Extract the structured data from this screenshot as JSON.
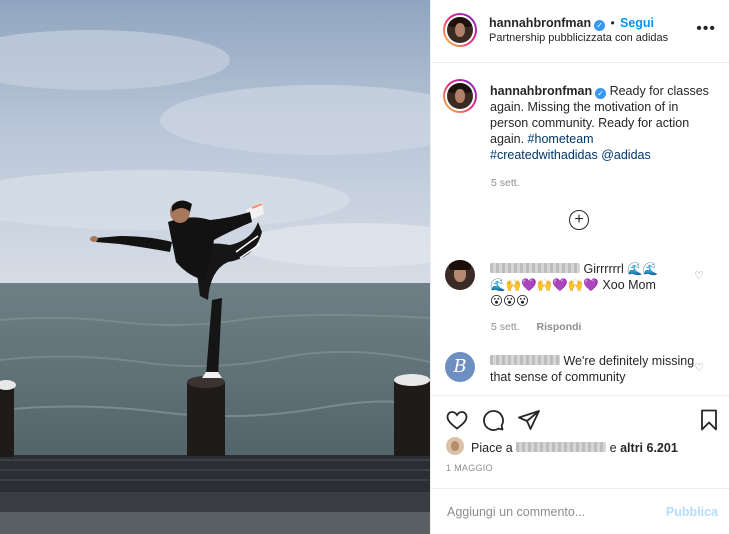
{
  "post": {
    "author": "hannahbronfman",
    "follow_label": "Segui",
    "partnership": "Partnership pubblicizzata con adidas",
    "more_icon": "more-options-icon",
    "caption_part1": "Ready for classes again. Missing the motivation of in person community. Ready for action again.",
    "caption_hashtag1": "#hometeam",
    "caption_hashtag2": "#createdwithadidas",
    "caption_mention": "@adidas",
    "caption_time": "5 sett.",
    "load_more_icon": "plus-circle-icon"
  },
  "comments": [
    {
      "text_line1": "Girrrrrrl 🌊🌊",
      "text_line2": "🌊🙌💜🙌💜🙌💜 Xoo Mom",
      "text_line3": "😮😮😮",
      "time": "5 sett.",
      "reply_label": "Rispondi"
    },
    {
      "text": "We're definitely missing that sense of community"
    }
  ],
  "actions": {
    "likes_prefix": "Piace a",
    "likes_suffix": "e",
    "likes_count": "altri 6.201",
    "date": "1 MAGGIO"
  },
  "comment_box": {
    "placeholder": "Aggiungi un commento...",
    "publish_label": "Pubblica"
  },
  "colors": {
    "link_blue": "#0095f6",
    "hashtag": "#00376b",
    "muted": "#8e8e8e",
    "publish_disabled": "#b2dffc"
  }
}
